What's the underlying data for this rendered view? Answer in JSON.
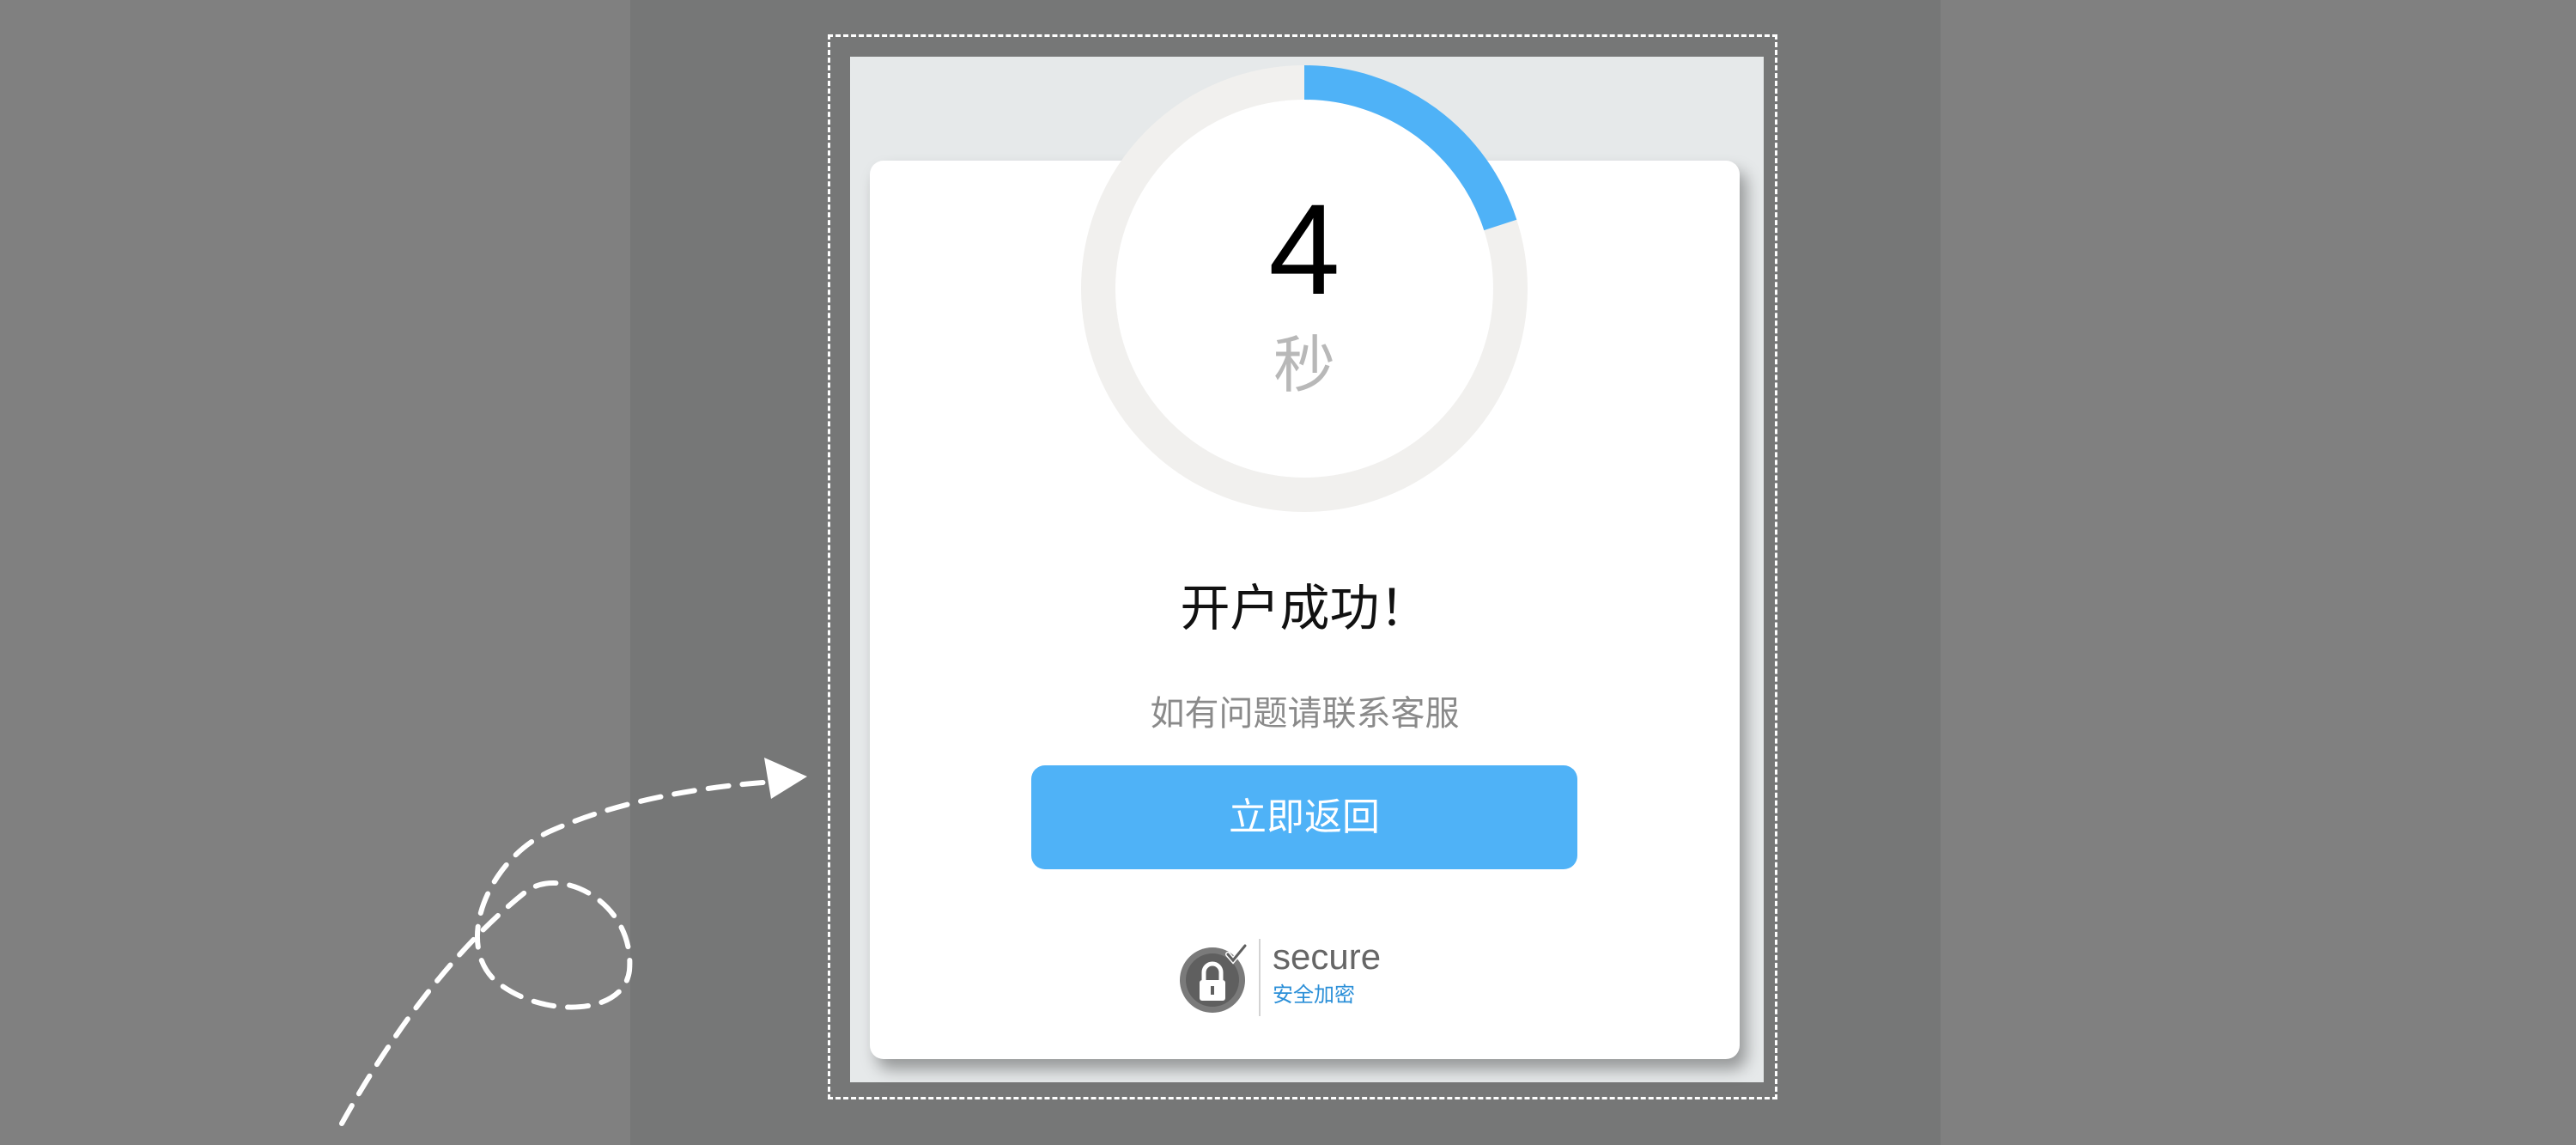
{
  "countdown": {
    "number": "4",
    "unit": "秒",
    "progress": 0.2,
    "track_color": "#f1f0ee",
    "progress_color": "#4fb2f7"
  },
  "message": {
    "title": "开户成功！",
    "subtitle": "如有问题请联系客服"
  },
  "actions": {
    "return_label": "立即返回"
  },
  "secure_badge": {
    "word": "secure",
    "subtitle": "安全加密",
    "icon": "lock-check-icon"
  },
  "colors": {
    "accent": "#4fb2f7",
    "background": "#808080"
  }
}
